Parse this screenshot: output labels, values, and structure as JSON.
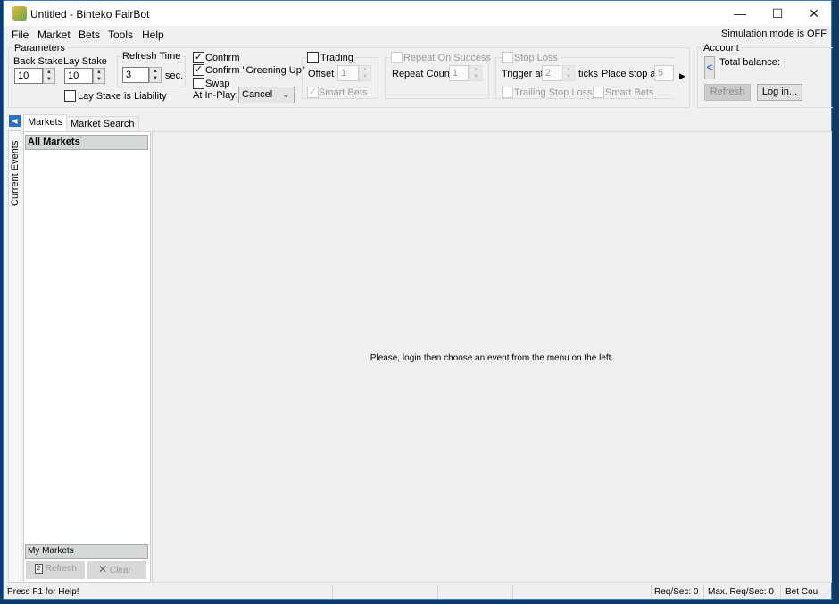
{
  "window": {
    "title": "Untitled - Binteko FairBot",
    "minimize": "—",
    "maximize": "☐",
    "close": "✕"
  },
  "menu": [
    "File",
    "Market",
    "Bets",
    "Tools",
    "Help"
  ],
  "simulation_mode": "Simulation mode is OFF",
  "parameters": {
    "label": "Parameters",
    "back_stake_label": "Back Stake",
    "back_stake": "10",
    "lay_stake_label": "Lay Stake",
    "lay_stake": "10",
    "refresh_time_label": "Refresh Time",
    "refresh_time": "3",
    "refresh_unit": "sec.",
    "lay_stake_liability": "Lay Stake is Liability",
    "confirm": "Confirm",
    "confirm_greening": "Confirm \"Greening Up\"",
    "swap": "Swap",
    "in_play_label": "At In-Play:",
    "in_play_value": "Cancel",
    "trading": "Trading",
    "offset_label": "Offset",
    "offset": "1",
    "smart_bets": "Smart Bets",
    "repeat_on_success": "Repeat On Success",
    "repeat_count_label": "Repeat Count",
    "repeat_count": "1",
    "stop_loss": "Stop Loss",
    "trigger_label": "Trigger at",
    "trigger": "2",
    "ticks": "ticks",
    "place_stop_label": "Place stop at",
    "place_stop": "5",
    "trailing_stop_loss": "Trailing Stop Loss",
    "stop_smart_bets": "Smart Bets"
  },
  "account": {
    "label": "Account",
    "collapse": "<",
    "total_balance": "Total balance:",
    "refresh": "Refresh",
    "login": "Log in..."
  },
  "tabs": [
    "Markets",
    "Market Search"
  ],
  "side_tab": "Current Events",
  "left_panel": {
    "all_markets": "All Markets",
    "my_markets": "My Markets",
    "refresh": "Refresh",
    "clear": "Clear"
  },
  "main_message": "Please, login then choose an event from the menu on the left.",
  "status": {
    "help": "Press F1 for Help!",
    "req_sec": "Req/Sec: 0",
    "max_req_sec": "Max. Req/Sec: 0",
    "bet_count": "Bet Cou"
  }
}
